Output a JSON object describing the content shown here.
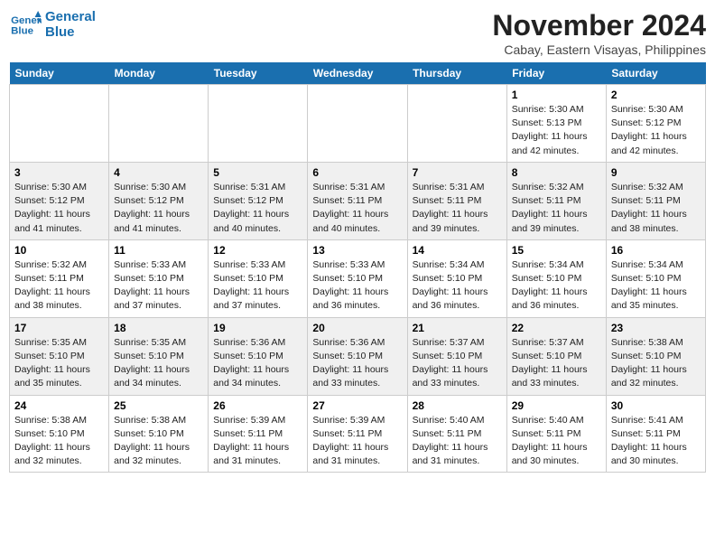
{
  "header": {
    "logo_line1": "General",
    "logo_line2": "Blue",
    "month_title": "November 2024",
    "location": "Cabay, Eastern Visayas, Philippines"
  },
  "weekdays": [
    "Sunday",
    "Monday",
    "Tuesday",
    "Wednesday",
    "Thursday",
    "Friday",
    "Saturday"
  ],
  "weeks": [
    [
      {
        "day": "",
        "info": ""
      },
      {
        "day": "",
        "info": ""
      },
      {
        "day": "",
        "info": ""
      },
      {
        "day": "",
        "info": ""
      },
      {
        "day": "",
        "info": ""
      },
      {
        "day": "1",
        "info": "Sunrise: 5:30 AM\nSunset: 5:13 PM\nDaylight: 11 hours\nand 42 minutes."
      },
      {
        "day": "2",
        "info": "Sunrise: 5:30 AM\nSunset: 5:12 PM\nDaylight: 11 hours\nand 42 minutes."
      }
    ],
    [
      {
        "day": "3",
        "info": "Sunrise: 5:30 AM\nSunset: 5:12 PM\nDaylight: 11 hours\nand 41 minutes."
      },
      {
        "day": "4",
        "info": "Sunrise: 5:30 AM\nSunset: 5:12 PM\nDaylight: 11 hours\nand 41 minutes."
      },
      {
        "day": "5",
        "info": "Sunrise: 5:31 AM\nSunset: 5:12 PM\nDaylight: 11 hours\nand 40 minutes."
      },
      {
        "day": "6",
        "info": "Sunrise: 5:31 AM\nSunset: 5:11 PM\nDaylight: 11 hours\nand 40 minutes."
      },
      {
        "day": "7",
        "info": "Sunrise: 5:31 AM\nSunset: 5:11 PM\nDaylight: 11 hours\nand 39 minutes."
      },
      {
        "day": "8",
        "info": "Sunrise: 5:32 AM\nSunset: 5:11 PM\nDaylight: 11 hours\nand 39 minutes."
      },
      {
        "day": "9",
        "info": "Sunrise: 5:32 AM\nSunset: 5:11 PM\nDaylight: 11 hours\nand 38 minutes."
      }
    ],
    [
      {
        "day": "10",
        "info": "Sunrise: 5:32 AM\nSunset: 5:11 PM\nDaylight: 11 hours\nand 38 minutes."
      },
      {
        "day": "11",
        "info": "Sunrise: 5:33 AM\nSunset: 5:10 PM\nDaylight: 11 hours\nand 37 minutes."
      },
      {
        "day": "12",
        "info": "Sunrise: 5:33 AM\nSunset: 5:10 PM\nDaylight: 11 hours\nand 37 minutes."
      },
      {
        "day": "13",
        "info": "Sunrise: 5:33 AM\nSunset: 5:10 PM\nDaylight: 11 hours\nand 36 minutes."
      },
      {
        "day": "14",
        "info": "Sunrise: 5:34 AM\nSunset: 5:10 PM\nDaylight: 11 hours\nand 36 minutes."
      },
      {
        "day": "15",
        "info": "Sunrise: 5:34 AM\nSunset: 5:10 PM\nDaylight: 11 hours\nand 36 minutes."
      },
      {
        "day": "16",
        "info": "Sunrise: 5:34 AM\nSunset: 5:10 PM\nDaylight: 11 hours\nand 35 minutes."
      }
    ],
    [
      {
        "day": "17",
        "info": "Sunrise: 5:35 AM\nSunset: 5:10 PM\nDaylight: 11 hours\nand 35 minutes."
      },
      {
        "day": "18",
        "info": "Sunrise: 5:35 AM\nSunset: 5:10 PM\nDaylight: 11 hours\nand 34 minutes."
      },
      {
        "day": "19",
        "info": "Sunrise: 5:36 AM\nSunset: 5:10 PM\nDaylight: 11 hours\nand 34 minutes."
      },
      {
        "day": "20",
        "info": "Sunrise: 5:36 AM\nSunset: 5:10 PM\nDaylight: 11 hours\nand 33 minutes."
      },
      {
        "day": "21",
        "info": "Sunrise: 5:37 AM\nSunset: 5:10 PM\nDaylight: 11 hours\nand 33 minutes."
      },
      {
        "day": "22",
        "info": "Sunrise: 5:37 AM\nSunset: 5:10 PM\nDaylight: 11 hours\nand 33 minutes."
      },
      {
        "day": "23",
        "info": "Sunrise: 5:38 AM\nSunset: 5:10 PM\nDaylight: 11 hours\nand 32 minutes."
      }
    ],
    [
      {
        "day": "24",
        "info": "Sunrise: 5:38 AM\nSunset: 5:10 PM\nDaylight: 11 hours\nand 32 minutes."
      },
      {
        "day": "25",
        "info": "Sunrise: 5:38 AM\nSunset: 5:10 PM\nDaylight: 11 hours\nand 32 minutes."
      },
      {
        "day": "26",
        "info": "Sunrise: 5:39 AM\nSunset: 5:11 PM\nDaylight: 11 hours\nand 31 minutes."
      },
      {
        "day": "27",
        "info": "Sunrise: 5:39 AM\nSunset: 5:11 PM\nDaylight: 11 hours\nand 31 minutes."
      },
      {
        "day": "28",
        "info": "Sunrise: 5:40 AM\nSunset: 5:11 PM\nDaylight: 11 hours\nand 31 minutes."
      },
      {
        "day": "29",
        "info": "Sunrise: 5:40 AM\nSunset: 5:11 PM\nDaylight: 11 hours\nand 30 minutes."
      },
      {
        "day": "30",
        "info": "Sunrise: 5:41 AM\nSunset: 5:11 PM\nDaylight: 11 hours\nand 30 minutes."
      }
    ]
  ]
}
